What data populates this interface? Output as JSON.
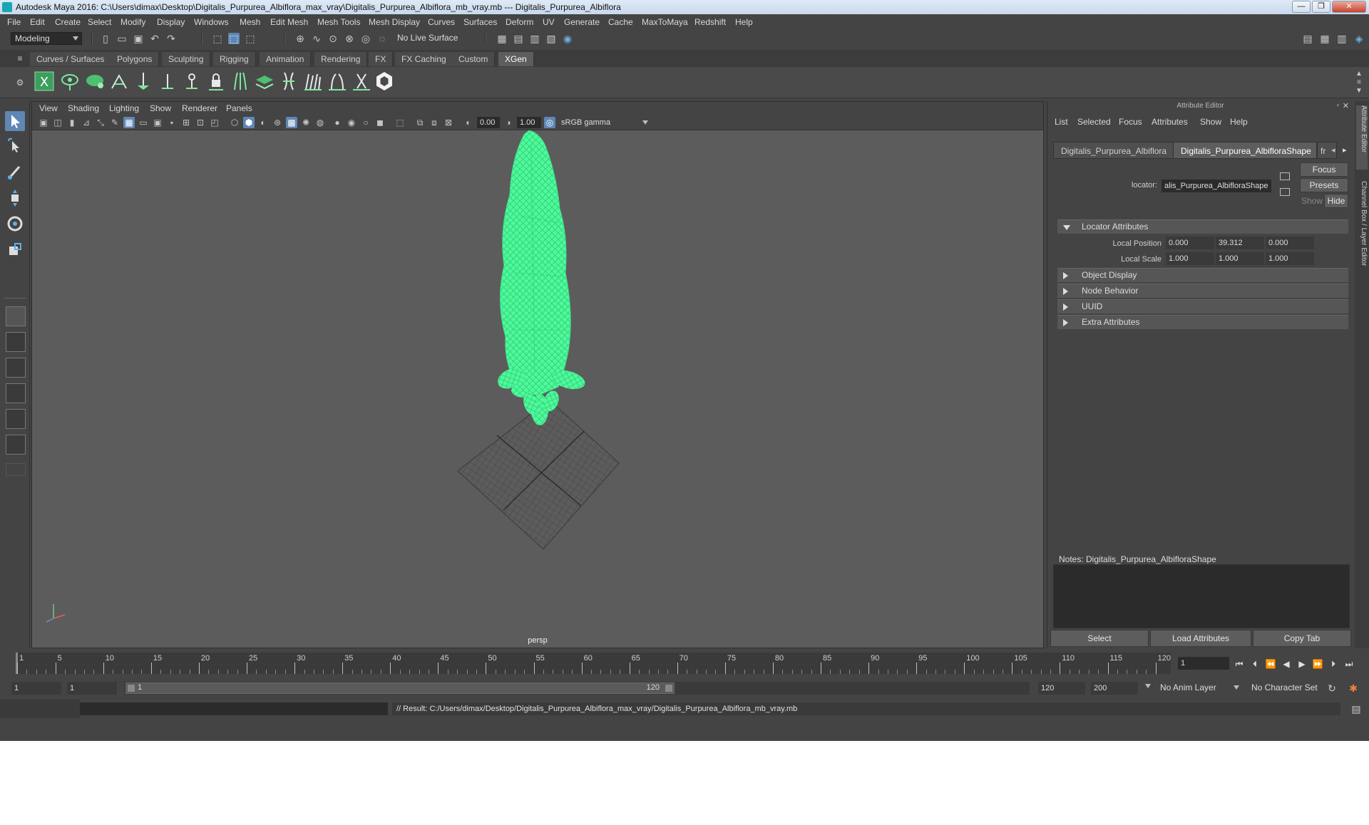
{
  "window": {
    "title": "Autodesk Maya 2016: C:\\Users\\dimax\\Desktop\\Digitalis_Purpurea_Albiflora_max_vray\\Digitalis_Purpurea_Albiflora_mb_vray.mb   ---   Digitalis_Purpurea_Albiflora",
    "minimize": "—",
    "maximize": "❐",
    "close": "✕"
  },
  "menu": [
    "File",
    "Edit",
    "Create",
    "Select",
    "Modify",
    "Display",
    "Windows",
    "Mesh",
    "Edit Mesh",
    "Mesh Tools",
    "Mesh Display",
    "Curves",
    "Surfaces",
    "Deform",
    "UV",
    "Generate",
    "Cache",
    "MaxToMaya",
    "Redshift",
    "Help"
  ],
  "statusline": {
    "mode": "Modeling",
    "live_surface": "No Live Surface"
  },
  "shelf": {
    "tabs": [
      "Curves / Surfaces",
      "Polygons",
      "Sculpting",
      "Rigging",
      "Animation",
      "Rendering",
      "FX",
      "FX Caching",
      "Custom",
      "XGen"
    ],
    "active_tab": "XGen"
  },
  "viewport": {
    "menu": [
      "View",
      "Shading",
      "Lighting",
      "Show",
      "Renderer",
      "Panels"
    ],
    "exposure": "0.00",
    "gamma": "1.00",
    "color_space": "sRGB gamma",
    "camera_label": "persp"
  },
  "attribute_editor": {
    "title": "Attribute Editor",
    "menu": [
      "List",
      "Selected",
      "Focus",
      "Attributes",
      "Show",
      "Help"
    ],
    "tabs": [
      "Digitalis_Purpurea_Albiflora",
      "Digitalis_Purpurea_AlbifloraShape",
      "fr"
    ],
    "active_tab": "Digitalis_Purpurea_AlbifloraShape",
    "node_type_label": "locator:",
    "node_name": "alis_Purpurea_AlbifloraShape",
    "focus_btn": "Focus",
    "presets_btn": "Presets",
    "show_btn": "Show",
    "hide_btn": "Hide",
    "sections": {
      "locator": "Locator Attributes",
      "object_display": "Object Display",
      "node_behavior": "Node Behavior",
      "uuid": "UUID",
      "extra": "Extra Attributes"
    },
    "local_position": {
      "label": "Local Position",
      "x": "0.000",
      "y": "39.312",
      "z": "0.000"
    },
    "local_scale": {
      "label": "Local Scale",
      "x": "1.000",
      "y": "1.000",
      "z": "1.000"
    },
    "notes_label": "Notes:  Digitalis_Purpurea_AlbifloraShape",
    "buttons": {
      "select": "Select",
      "load": "Load Attributes",
      "copy": "Copy Tab"
    }
  },
  "side_tabs": [
    "Attribute Editor",
    "Channel Box / Layer Editor"
  ],
  "timeline": {
    "tick_labels": [
      "1",
      "5",
      "10",
      "15",
      "20",
      "25",
      "30",
      "35",
      "40",
      "45",
      "50",
      "55",
      "60",
      "65",
      "70",
      "75",
      "80",
      "85",
      "90",
      "95",
      "100",
      "105",
      "110",
      "115",
      "120"
    ],
    "current_frame": "1",
    "start_frame": "1",
    "playback_start": "1",
    "range_start_label": "1",
    "range_end_label": "120",
    "playback_end": "120",
    "end_frame": "200",
    "anim_layer": "No Anim Layer",
    "character_set": "No Character Set"
  },
  "command": {
    "result": "// Result: C:/Users/dimax/Desktop/Digitalis_Purpurea_Albiflora_max_vray/Digitalis_Purpurea_Albiflora_mb_vray.mb"
  },
  "colors": {
    "accent": "#5f87b5",
    "mesh": "#4dfa9a",
    "viewport_bg": "#5c5c5c"
  }
}
